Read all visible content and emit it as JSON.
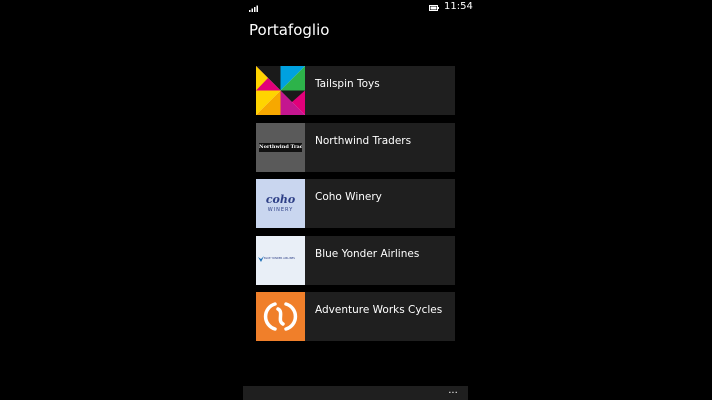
{
  "status_bar": {
    "time": "11:54",
    "signal_icon": "signal-icon",
    "battery_icon": "battery-icon"
  },
  "page": {
    "title": "Portafoglio"
  },
  "companies": [
    {
      "name": "Tailspin Toys",
      "logo": "tailspin-toys-logo"
    },
    {
      "name": "Northwind Traders",
      "logo": "northwind-traders-logo",
      "logo_text": "Northwind Traders"
    },
    {
      "name": "Coho Winery",
      "logo": "coho-winery-logo",
      "logo_text": "coho",
      "logo_subtext": "WINERY"
    },
    {
      "name": "Blue Yonder Airlines",
      "logo": "blue-yonder-airlines-logo",
      "logo_text": "BLUE YONDER AIRLINES"
    },
    {
      "name": "Adventure Works Cycles",
      "logo": "adventure-works-cycles-logo"
    }
  ],
  "app_bar": {
    "more_label": "...",
    "more_icon": "more-icon"
  },
  "colors": {
    "background": "#000000",
    "tile": "#1f1f1f",
    "northwind_bg": "#5a5a5a",
    "coho_bg": "#c9d6ef",
    "blue_yonder_bg": "#e9eff7",
    "adventure_orange": "#f07f2a"
  }
}
